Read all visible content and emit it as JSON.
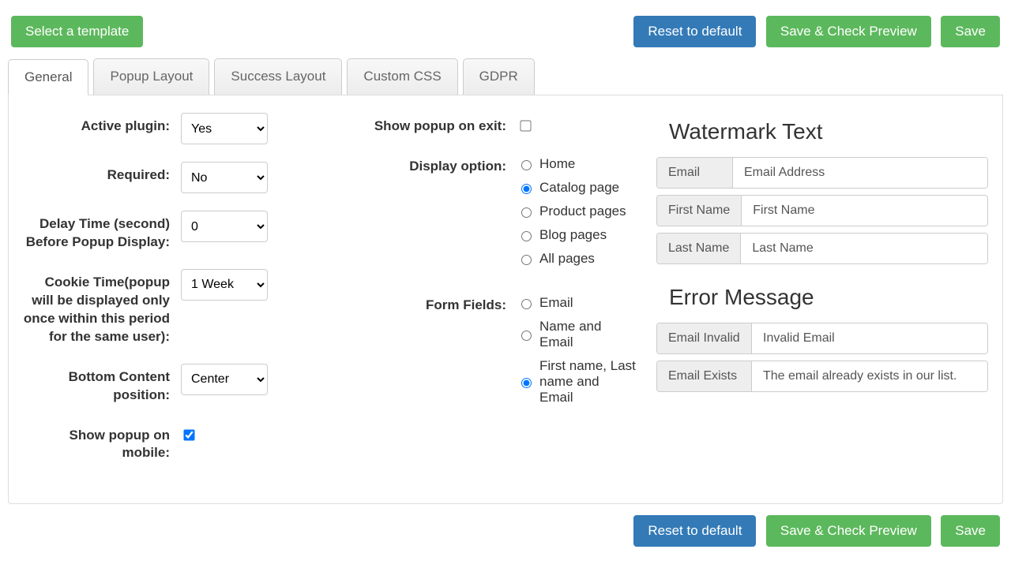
{
  "topbar": {
    "select_template": "Select a template",
    "reset": "Reset to default",
    "save_preview": "Save & Check Preview",
    "save": "Save"
  },
  "tabs": {
    "general": "General",
    "popup_layout": "Popup Layout",
    "success_layout": "Success Layout",
    "custom_css": "Custom CSS",
    "gdpr": "GDPR"
  },
  "col1": {
    "active_plugin_label": "Active plugin:",
    "active_plugin_value": "Yes",
    "required_label": "Required:",
    "required_value": "No",
    "delay_label": "Delay Time (second) Before Popup Display:",
    "delay_value": "0",
    "cookie_label": "Cookie Time(popup will be displayed only once within this period for the same user):",
    "cookie_value": "1 Week",
    "bottom_content_label": "Bottom Content position:",
    "bottom_content_value": "Center",
    "show_mobile_label": "Show popup on mobile:"
  },
  "col2": {
    "show_exit_label": "Show popup on exit:",
    "display_option_label": "Display option:",
    "display_options": {
      "home": "Home",
      "catalog": "Catalog page",
      "product": "Product pages",
      "blog": "Blog pages",
      "all": "All pages"
    },
    "form_fields_label": "Form Fields:",
    "form_fields": {
      "email": "Email",
      "name_email": "Name and Email",
      "full": "First name, Last name and Email"
    }
  },
  "col3": {
    "watermark_head": "Watermark Text",
    "email_addon": "Email",
    "email_value": "Email Address",
    "firstname_addon": "First Name",
    "firstname_value": "First Name",
    "lastname_addon": "Last Name",
    "lastname_value": "Last Name",
    "error_head": "Error Message",
    "einvalid_addon": "Email Invalid",
    "einvalid_value": "Invalid Email",
    "eexists_addon": "Email Exists",
    "eexists_value": "The email already exists in our list."
  }
}
